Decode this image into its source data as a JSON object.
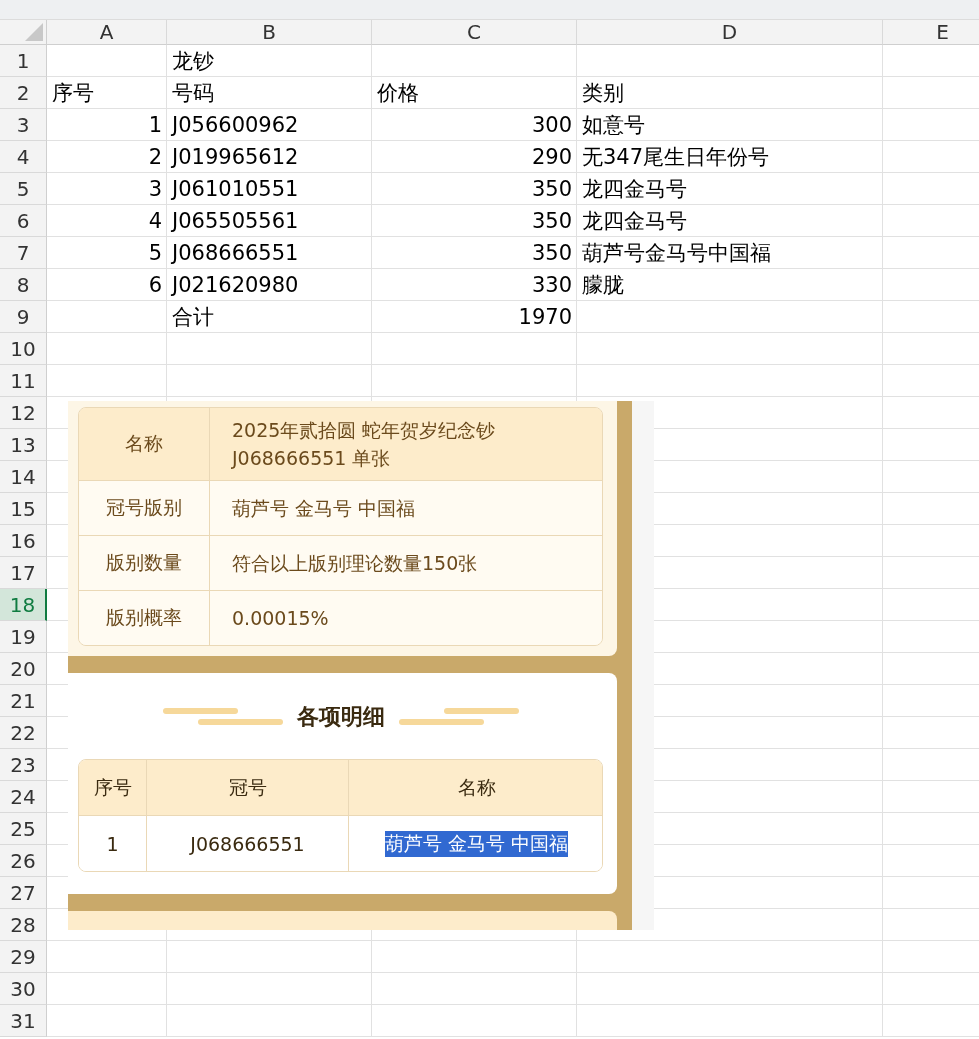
{
  "sheet": {
    "columns": [
      {
        "label": "A",
        "selected": false
      },
      {
        "label": "B",
        "selected": false
      },
      {
        "label": "C",
        "selected": false
      },
      {
        "label": "D",
        "selected": false
      },
      {
        "label": "E",
        "selected": false
      }
    ],
    "rows": [
      {
        "label": "1",
        "selected": false,
        "cells": [
          null,
          {
            "text": "龙钞",
            "kind": "text"
          },
          null,
          null
        ]
      },
      {
        "label": "2",
        "selected": false,
        "cells": [
          {
            "text": "序号",
            "kind": "text"
          },
          {
            "text": "号码",
            "kind": "text"
          },
          {
            "text": "价格",
            "kind": "text"
          },
          {
            "text": "类别",
            "kind": "text"
          }
        ]
      },
      {
        "label": "3",
        "selected": false,
        "cells": [
          {
            "text": "1",
            "kind": "number"
          },
          {
            "text": "J056600962",
            "kind": "text"
          },
          {
            "text": "300",
            "kind": "number"
          },
          {
            "text": "如意号",
            "kind": "text"
          }
        ]
      },
      {
        "label": "4",
        "selected": false,
        "cells": [
          {
            "text": "2",
            "kind": "number"
          },
          {
            "text": "J019965612",
            "kind": "text"
          },
          {
            "text": "290",
            "kind": "number"
          },
          {
            "text": "无347尾生日年份号",
            "kind": "text"
          }
        ]
      },
      {
        "label": "5",
        "selected": false,
        "cells": [
          {
            "text": "3",
            "kind": "number"
          },
          {
            "text": "J061010551",
            "kind": "text"
          },
          {
            "text": "350",
            "kind": "number"
          },
          {
            "text": "龙四金马号",
            "kind": "text"
          }
        ]
      },
      {
        "label": "6",
        "selected": false,
        "cells": [
          {
            "text": "4",
            "kind": "number"
          },
          {
            "text": "J065505561",
            "kind": "text"
          },
          {
            "text": "350",
            "kind": "number"
          },
          {
            "text": "龙四金马号",
            "kind": "text"
          }
        ]
      },
      {
        "label": "7",
        "selected": false,
        "cells": [
          {
            "text": "5",
            "kind": "number"
          },
          {
            "text": "J068666551",
            "kind": "text"
          },
          {
            "text": "350",
            "kind": "number"
          },
          {
            "text": "葫芦号金马号中国福",
            "kind": "text"
          }
        ]
      },
      {
        "label": "8",
        "selected": false,
        "cells": [
          {
            "text": "6",
            "kind": "number"
          },
          {
            "text": "J021620980",
            "kind": "text"
          },
          {
            "text": "330",
            "kind": "number"
          },
          {
            "text": "朦胧",
            "kind": "text"
          }
        ]
      },
      {
        "label": "9",
        "selected": false,
        "cells": [
          null,
          {
            "text": "合计",
            "kind": "text"
          },
          {
            "text": "1970",
            "kind": "number"
          },
          null
        ]
      },
      {
        "label": "10",
        "selected": false
      },
      {
        "label": "11",
        "selected": false
      },
      {
        "label": "12",
        "selected": false
      },
      {
        "label": "13",
        "selected": false
      },
      {
        "label": "14",
        "selected": false
      },
      {
        "label": "15",
        "selected": false
      },
      {
        "label": "16",
        "selected": false
      },
      {
        "label": "17",
        "selected": false
      },
      {
        "label": "18",
        "selected": true
      },
      {
        "label": "19",
        "selected": false
      },
      {
        "label": "20",
        "selected": false
      },
      {
        "label": "21",
        "selected": false
      },
      {
        "label": "22",
        "selected": false
      },
      {
        "label": "23",
        "selected": false
      },
      {
        "label": "24",
        "selected": false
      },
      {
        "label": "25",
        "selected": false
      },
      {
        "label": "26",
        "selected": false
      },
      {
        "label": "27",
        "selected": false
      },
      {
        "label": "28",
        "selected": false
      },
      {
        "label": "29",
        "selected": false
      },
      {
        "label": "30",
        "selected": false
      },
      {
        "label": "31",
        "selected": false
      }
    ]
  },
  "embedded_screenshot": {
    "info_table": [
      {
        "label": "名称",
        "value_lines": [
          "2025年贰拾圆 蛇年贺岁纪念钞",
          "J068666551 单张"
        ]
      },
      {
        "label": "冠号版别",
        "value_lines": [
          "葫芦号 金马号 中国福"
        ]
      },
      {
        "label": "版别数量",
        "value_lines": [
          "符合以上版别理论数量150张"
        ]
      },
      {
        "label": "版别概率",
        "value_lines": [
          "0.00015%"
        ]
      }
    ],
    "detail": {
      "title": "各项明细",
      "columns": [
        "序号",
        "冠号",
        "名称"
      ],
      "rows": [
        {
          "cells": [
            {
              "text": "1",
              "selected": false
            },
            {
              "text": "J068666551",
              "selected": false
            },
            {
              "text": "葫芦号 金马号 中国福",
              "selected": true
            }
          ]
        }
      ]
    }
  }
}
